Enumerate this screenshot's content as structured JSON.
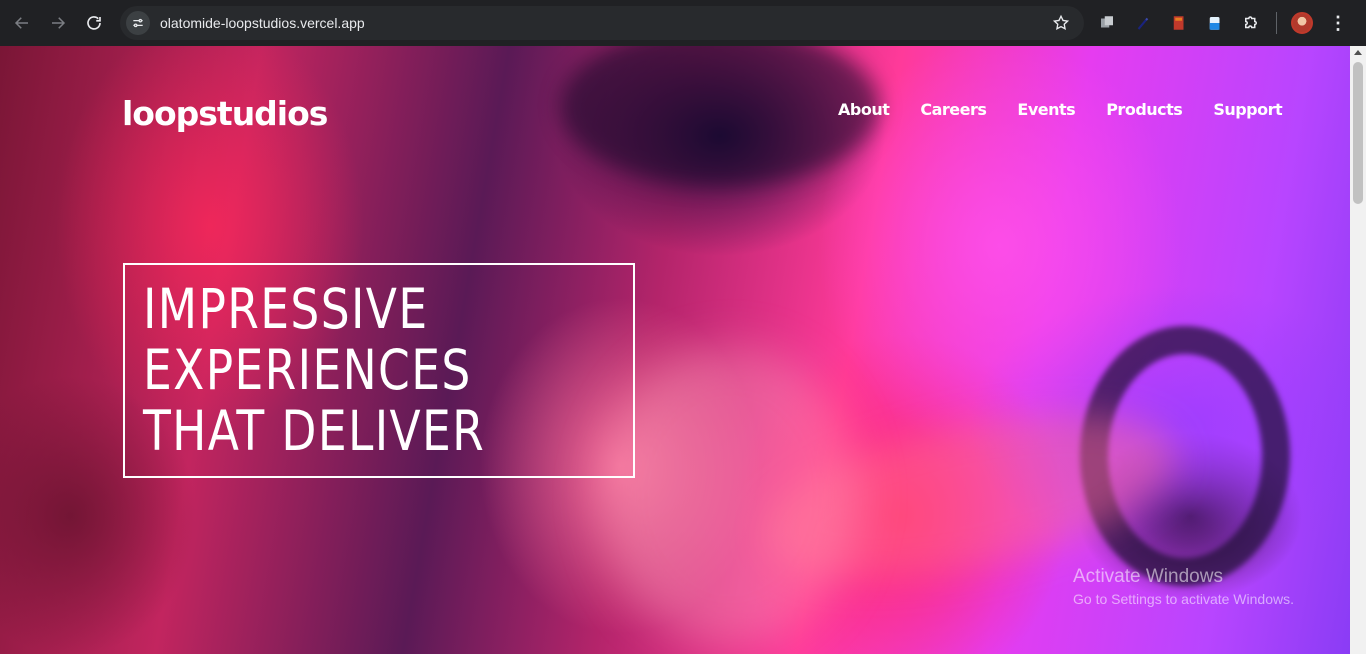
{
  "browser": {
    "url": "olatomide-loopstudios.vercel.app",
    "back_icon": "arrow-left-icon",
    "forward_icon": "arrow-right-icon",
    "reload_icon": "reload-icon",
    "bookmark_icon": "star-icon",
    "extensions": [
      "puzzle-extension-icon",
      "pen-extension-icon",
      "book-extension-icon",
      "clipboard-extension-icon",
      "extensions-menu-icon"
    ],
    "menu_label": "⋮"
  },
  "site": {
    "logo": "loopstudios",
    "nav": [
      "About",
      "Careers",
      "Events",
      "Products",
      "Support"
    ],
    "headline": [
      "IMPRESSIVE",
      "EXPERIENCES",
      "THAT DELIVER"
    ]
  },
  "os_overlay": {
    "title": "Activate Windows",
    "subtitle": "Go to Settings to activate Windows."
  },
  "colors": {
    "chrome_bg": "#202124",
    "omnibox_bg": "#282a2d",
    "hero_accent_pink": "#ff3a9a",
    "hero_accent_violet": "#b845ff"
  }
}
